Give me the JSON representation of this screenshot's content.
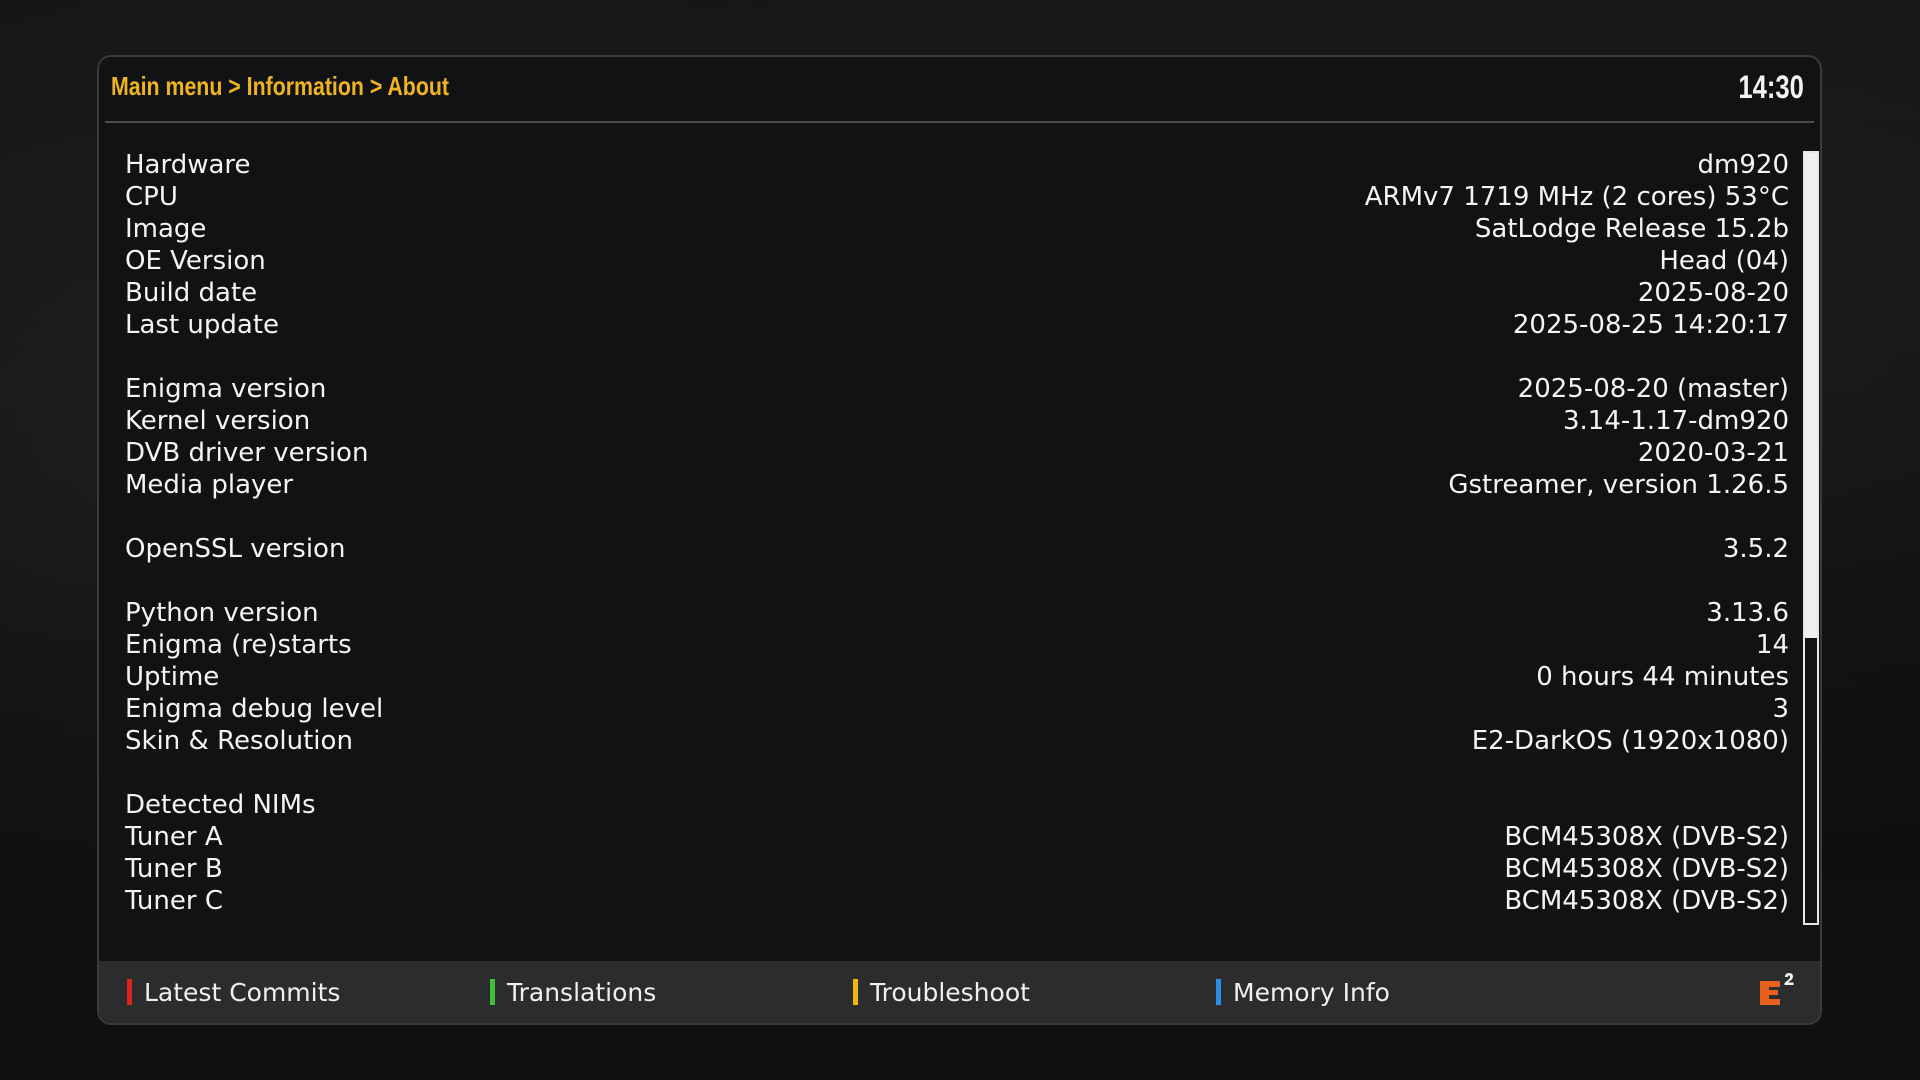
{
  "header": {
    "breadcrumb": "Main menu > Information > About",
    "clock": "14:30"
  },
  "info": [
    {
      "label": "Hardware",
      "value": "dm920"
    },
    {
      "label": "CPU",
      "value": "ARMv7 1719 MHz (2 cores) 53°C"
    },
    {
      "label": "Image",
      "value": "SatLodge Release 15.2b"
    },
    {
      "label": "OE Version",
      "value": "Head (04)"
    },
    {
      "label": "Build date",
      "value": "2025-08-20"
    },
    {
      "label": "Last update",
      "value": "2025-08-25 14:20:17"
    },
    {
      "label": "",
      "value": ""
    },
    {
      "label": "Enigma version",
      "value": "2025-08-20 (master)"
    },
    {
      "label": "Kernel version",
      "value": "3.14-1.17-dm920"
    },
    {
      "label": "DVB driver version",
      "value": "2020-03-21"
    },
    {
      "label": "Media player",
      "value": "Gstreamer, version 1.26.5"
    },
    {
      "label": "",
      "value": ""
    },
    {
      "label": "OpenSSL version",
      "value": "3.5.2"
    },
    {
      "label": "",
      "value": ""
    },
    {
      "label": "Python version",
      "value": "3.13.6"
    },
    {
      "label": "Enigma (re)starts",
      "value": "14"
    },
    {
      "label": "Uptime",
      "value": "0 hours 44 minutes"
    },
    {
      "label": "Enigma debug level",
      "value": "3"
    },
    {
      "label": "Skin & Resolution",
      "value": "E2-DarkOS (1920x1080)"
    },
    {
      "label": "",
      "value": ""
    },
    {
      "label": "Detected NIMs",
      "value": ""
    },
    {
      "label": "Tuner A",
      "value": "BCM45308X (DVB-S2)"
    },
    {
      "label": "Tuner B",
      "value": "BCM45308X (DVB-S2)"
    },
    {
      "label": "Tuner C",
      "value": "BCM45308X (DVB-S2)"
    }
  ],
  "scrollbar": {
    "visible_fraction": 0.63
  },
  "footer": {
    "red_label": "Latest Commits",
    "green_label": "Translations",
    "yellow_label": "Troubleshoot",
    "blue_label": "Memory Info",
    "red_color": "#e0221b",
    "green_color": "#3fbf3a",
    "yellow_color": "#f2b411",
    "blue_color": "#2e8fe0",
    "logo_icon": "e2-logo-icon"
  }
}
